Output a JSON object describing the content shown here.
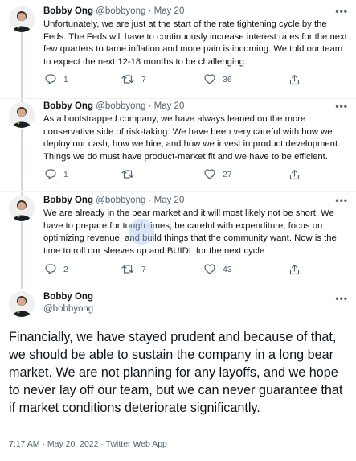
{
  "thread": [
    {
      "name": "Bobby Ong",
      "handle": "@bobbyong",
      "sep": "·",
      "date": "May 20",
      "text": "Unfortunately, we are just at the start of the rate tightening cycle by the Feds. The Feds will have to continuously increase interest rates for the next few quarters to tame inflation and more pain is incoming. We told our team to expect the next 12-18 months to be challenging.",
      "replies": "1",
      "retweets": "7",
      "likes": "36"
    },
    {
      "name": "Bobby Ong",
      "handle": "@bobbyong",
      "sep": "·",
      "date": "May 20",
      "text": "As a bootstrapped company, we have always leaned on the more conservative side of risk-taking. We have been very careful with how we deploy our cash, how we hire, and how we invest in product development. Things we do must have product-market fit and we have to be efficient.",
      "replies": "1",
      "retweets": "",
      "likes": "27"
    },
    {
      "name": "Bobby Ong",
      "handle": "@bobbyong",
      "sep": "·",
      "date": "May 20",
      "text": "We are already in the bear market and it will most likely not be short. We have to prepare for tough times, be careful with expenditure, focus on optimizing revenue, and build things that the community want. Now is the time to roll our sleeves up and BUIDL for the next cycle",
      "replies": "2",
      "retweets": "7",
      "likes": "43"
    }
  ],
  "main_tweet": {
    "name": "Bobby Ong",
    "handle": "@bobbyong",
    "text": "Financially, we have stayed prudent and because of that, we should be able to sustain the company in a long bear market. We are not planning for any layoffs, and we hope to never lay off our team, but we can never guarantee that if market conditions deteriorate significantly.",
    "timestamp": "7:17 AM · May 20, 2022 · Twitter Web App"
  },
  "more_glyph": "•••",
  "colors": {
    "text": "#0f1419",
    "secondary": "#536471",
    "thread_line": "#cfd9de"
  }
}
